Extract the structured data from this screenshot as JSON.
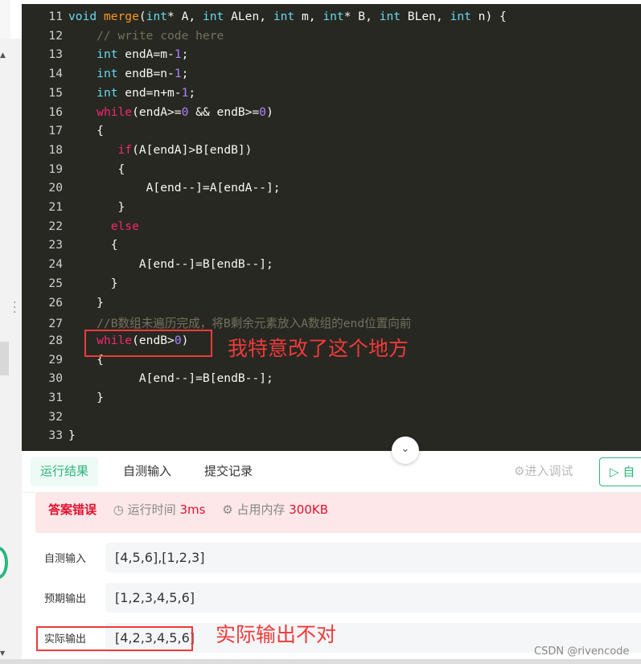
{
  "code": {
    "lines": [
      {
        "n": "11",
        "tokens": [
          [
            "void ",
            "kw"
          ],
          [
            "merge",
            "fn"
          ],
          [
            "(",
            "pl"
          ],
          [
            "int",
            "kw"
          ],
          [
            "* A, ",
            "pl"
          ],
          [
            "int",
            "kw"
          ],
          [
            " ALen, ",
            "pl"
          ],
          [
            "int",
            "kw"
          ],
          [
            " m, ",
            "pl"
          ],
          [
            "int",
            "kw"
          ],
          [
            "* B, ",
            "pl"
          ],
          [
            "int",
            "kw"
          ],
          [
            " BLen, ",
            "pl"
          ],
          [
            "int",
            "kw"
          ],
          [
            " n) {",
            "pl"
          ]
        ]
      },
      {
        "n": "12",
        "tokens": [
          [
            "    // write code here",
            "cm"
          ]
        ]
      },
      {
        "n": "13",
        "tokens": [
          [
            "    ",
            "pl"
          ],
          [
            "int",
            "kw"
          ],
          [
            " endA=m-",
            "pl"
          ],
          [
            "1",
            "num"
          ],
          [
            ";",
            "pl"
          ]
        ]
      },
      {
        "n": "14",
        "tokens": [
          [
            "    ",
            "pl"
          ],
          [
            "int",
            "kw"
          ],
          [
            " endB=n-",
            "pl"
          ],
          [
            "1",
            "num"
          ],
          [
            ";",
            "pl"
          ]
        ]
      },
      {
        "n": "15",
        "tokens": [
          [
            "    ",
            "pl"
          ],
          [
            "int",
            "kw"
          ],
          [
            " end=n+m-",
            "pl"
          ],
          [
            "1",
            "num"
          ],
          [
            ";",
            "pl"
          ]
        ]
      },
      {
        "n": "16",
        "tokens": [
          [
            "    ",
            "pl"
          ],
          [
            "while",
            "ctl"
          ],
          [
            "(endA>=",
            "pl"
          ],
          [
            "0",
            "num"
          ],
          [
            " && endB>=",
            "pl"
          ],
          [
            "0",
            "num"
          ],
          [
            ")",
            "pl"
          ]
        ]
      },
      {
        "n": "17",
        "tokens": [
          [
            "    {",
            "pl"
          ]
        ]
      },
      {
        "n": "18",
        "tokens": [
          [
            "       ",
            "pl"
          ],
          [
            "if",
            "ctl"
          ],
          [
            "(A[endA]>B[endB])",
            "pl"
          ]
        ]
      },
      {
        "n": "19",
        "tokens": [
          [
            "       {",
            "pl"
          ]
        ]
      },
      {
        "n": "20",
        "tokens": [
          [
            "           A[end--]=A[endA--];",
            "pl"
          ]
        ]
      },
      {
        "n": "21",
        "tokens": [
          [
            "       }",
            "pl"
          ]
        ]
      },
      {
        "n": "22",
        "tokens": [
          [
            "      ",
            "pl"
          ],
          [
            "else",
            "ctl"
          ]
        ]
      },
      {
        "n": "23",
        "tokens": [
          [
            "      {",
            "pl"
          ]
        ]
      },
      {
        "n": "24",
        "tokens": [
          [
            "          A[end--]=B[endB--];",
            "pl"
          ]
        ]
      },
      {
        "n": "25",
        "tokens": [
          [
            "      }",
            "pl"
          ]
        ]
      },
      {
        "n": "26",
        "tokens": [
          [
            "    }",
            "pl"
          ]
        ]
      },
      {
        "n": "27",
        "tokens": [
          [
            "    //B数组未遍历完成，将B剩余元素放入A数组的end位置向前",
            "cm"
          ]
        ]
      },
      {
        "n": "28",
        "tokens": [
          [
            "    ",
            "pl"
          ],
          [
            "while",
            "ctl"
          ],
          [
            "(endB>",
            "pl"
          ],
          [
            "0",
            "num"
          ],
          [
            ")",
            "pl"
          ]
        ]
      },
      {
        "n": "29",
        "tokens": [
          [
            "    {",
            "pl"
          ]
        ]
      },
      {
        "n": "30",
        "tokens": [
          [
            "          A[end--]=B[endB--];",
            "pl"
          ]
        ]
      },
      {
        "n": "31",
        "tokens": [
          [
            "    }",
            "pl"
          ]
        ]
      },
      {
        "n": "32",
        "tokens": []
      },
      {
        "n": "33",
        "tokens": [
          [
            "}",
            "pl"
          ]
        ]
      }
    ]
  },
  "annotations": {
    "line28_note": "我特意改了这个地方",
    "actual_note": "实际输出不对"
  },
  "tabs": [
    {
      "label": "运行结果",
      "active": true
    },
    {
      "label": "自测输入",
      "active": false
    },
    {
      "label": "提交记录",
      "active": false
    }
  ],
  "toolbar": {
    "debug_label": "进入调试",
    "run_label": "自"
  },
  "result": {
    "status": "答案错误",
    "time_label": "运行时间",
    "time_value": "3ms",
    "memory_label": "占用内存",
    "memory_value": "300KB"
  },
  "io": {
    "input_label": "自测输入",
    "input_value": "[4,5,6],[1,2,3]",
    "expected_label": "预期输出",
    "expected_value": "[1,2,3,4,5,6]",
    "actual_label": "实际输出",
    "actual_value": "[4,2,3,4,5,6]"
  },
  "watermark": "CSDN @rivencode",
  "colors": {
    "accent": "#2cb67d",
    "error": "#e0112f",
    "editor_bg": "#272822",
    "annotation": "#f03a3a"
  }
}
